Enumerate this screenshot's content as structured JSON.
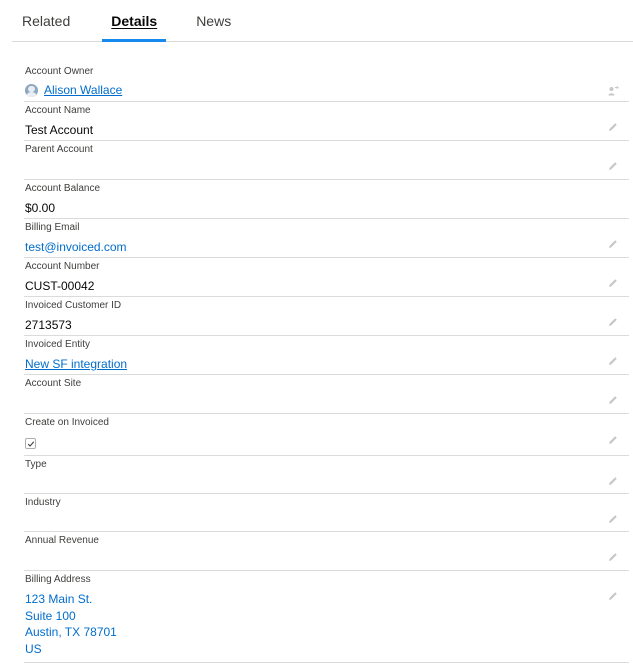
{
  "tabs": {
    "related": "Related",
    "details": "Details",
    "news": "News"
  },
  "fields": {
    "account_owner": {
      "label": "Account Owner",
      "value": "Alison Wallace"
    },
    "account_name": {
      "label": "Account Name",
      "value": "Test Account"
    },
    "parent_account": {
      "label": "Parent Account",
      "value": ""
    },
    "account_balance": {
      "label": "Account Balance",
      "value": "$0.00"
    },
    "billing_email": {
      "label": "Billing Email",
      "value": "test@invoiced.com"
    },
    "account_number": {
      "label": "Account Number",
      "value": "CUST-00042"
    },
    "invoiced_customer_id": {
      "label": "Invoiced Customer ID",
      "value": "2713573"
    },
    "invoiced_entity": {
      "label": "Invoiced Entity",
      "value": "New SF integration"
    },
    "account_site": {
      "label": "Account Site",
      "value": ""
    },
    "create_on_invoiced": {
      "label": "Create on Invoiced",
      "checked": true
    },
    "type": {
      "label": "Type",
      "value": ""
    },
    "industry": {
      "label": "Industry",
      "value": ""
    },
    "annual_revenue": {
      "label": "Annual Revenue",
      "value": ""
    },
    "billing_address": {
      "label": "Billing Address",
      "lines": [
        "123 Main St.",
        "Suite 100",
        "Austin, TX 78701",
        "US"
      ]
    }
  },
  "icons": {
    "edit": "pencil-icon",
    "owner_change": "change-owner-icon",
    "checkmark": "checkmark-icon",
    "avatar": "user-avatar"
  },
  "colors": {
    "link": "#006dcc",
    "tab_active_indicator": "#1589ee",
    "divider": "#dddbda",
    "icon_gray": "#c9c7c5"
  }
}
